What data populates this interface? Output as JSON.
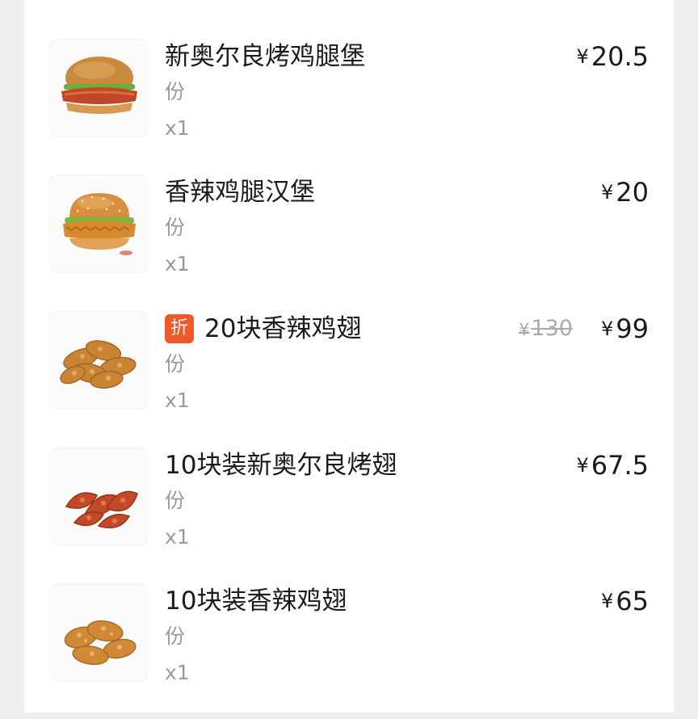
{
  "order": {
    "items": [
      {
        "name": "新奥尔良烤鸡腿堡",
        "unit": "份",
        "qty": "x1",
        "currency": "¥",
        "price": "20.5",
        "image": "burger-orleans-image"
      },
      {
        "name": "香辣鸡腿汉堡",
        "unit": "份",
        "qty": "x1",
        "currency": "¥",
        "price": "20",
        "image": "burger-spicy-image"
      },
      {
        "name": "20块香辣鸡翅",
        "badge": "折",
        "unit": "份",
        "qty": "x1",
        "currency": "¥",
        "original_price": "130",
        "price": "99",
        "image": "spicy-wings-image"
      },
      {
        "name": "10块装新奥尔良烤翅",
        "unit": "份",
        "qty": "x1",
        "currency": "¥",
        "price": "67.5",
        "image": "roasted-wings-image"
      },
      {
        "name": "10块装香辣鸡翅",
        "unit": "份",
        "qty": "x1",
        "currency": "¥",
        "price": "65",
        "image": "spicy-wings-image"
      }
    ]
  },
  "colors": {
    "background": "#efefef",
    "card": "#ffffff",
    "text": "#1b1b1b",
    "muted": "#9a9a9a",
    "badge": "#f2592a"
  }
}
